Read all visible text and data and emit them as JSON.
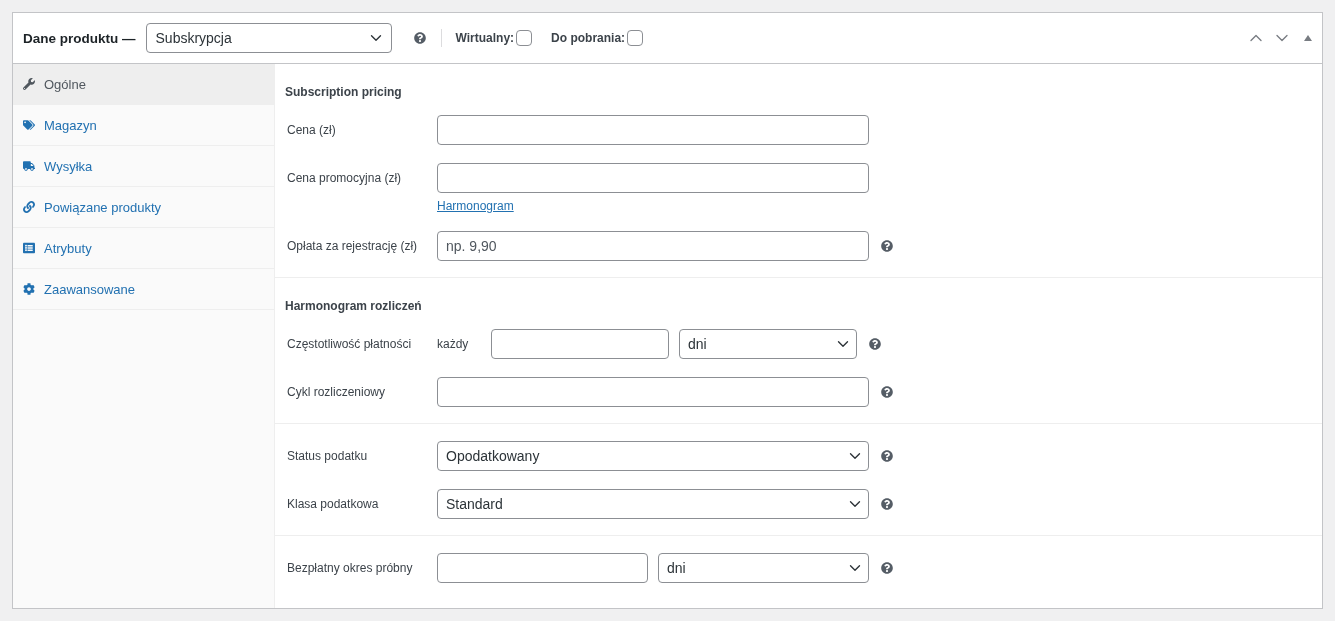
{
  "header": {
    "title": "Dane produktu —",
    "product_type": "Subskrypcja",
    "help": true,
    "options": [
      {
        "label": "Wirtualny:",
        "checked": false
      },
      {
        "label": "Do pobrania:",
        "checked": false
      }
    ]
  },
  "tabs": [
    {
      "label": "Ogólne",
      "selected": true
    },
    {
      "label": "Magazyn",
      "selected": false
    },
    {
      "label": "Wysyłka",
      "selected": false
    },
    {
      "label": "Powiązane produkty",
      "selected": false
    },
    {
      "label": "Atrybuty",
      "selected": false
    },
    {
      "label": "Zaawansowane",
      "selected": false
    }
  ],
  "sections": [
    {
      "heading": "Subscription pricing",
      "fields": [
        {
          "kind": "text",
          "label": "Cena (zł)",
          "help": false
        },
        {
          "kind": "text",
          "label": "Cena promocyjna (zł)",
          "link": "Harmonogram",
          "help": false
        },
        {
          "kind": "text",
          "label": "Opłata za rejestrację (zł)",
          "placeholder": "np. 9,90",
          "help": true
        }
      ]
    },
    {
      "heading": "Harmonogram rozliczeń",
      "fields": [
        {
          "kind": "interval",
          "label": "Częstotliwość płatności",
          "prefix": "każdy",
          "value": "dni",
          "help": true
        },
        {
          "kind": "text",
          "label": "Cykl rozliczeniowy",
          "help": true
        }
      ]
    },
    {
      "fields": [
        {
          "kind": "select",
          "label": "Status podatku",
          "value": "Opodatkowany",
          "help": true
        },
        {
          "kind": "select",
          "label": "Klasa podatkowa",
          "value": "Standard",
          "help": true
        }
      ]
    },
    {
      "fields": [
        {
          "kind": "trial",
          "label": "Bezpłatny okres próbny",
          "value": "dni",
          "help": true
        }
      ]
    }
  ]
}
